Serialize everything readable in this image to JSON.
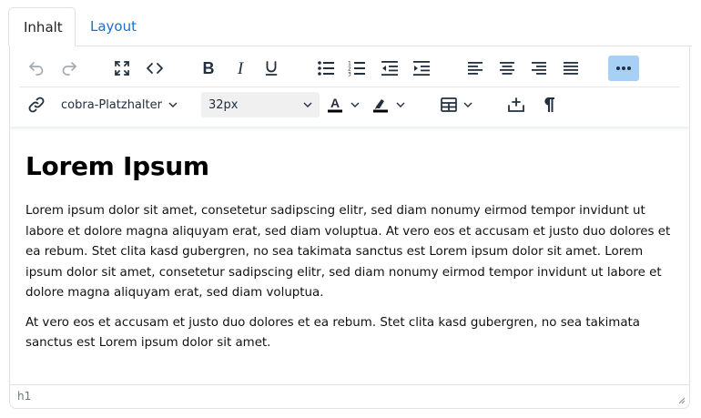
{
  "tabs": [
    {
      "label": "Inhalt",
      "active": true
    },
    {
      "label": "Layout",
      "active": false
    }
  ],
  "toolbar": {
    "row1": [
      {
        "name": "undo-icon",
        "disabled": true
      },
      {
        "name": "redo-icon",
        "disabled": true
      },
      {
        "name": "fullscreen-icon"
      },
      {
        "name": "source-code-icon"
      },
      {
        "name": "bold-icon"
      },
      {
        "name": "italic-icon"
      },
      {
        "name": "underline-icon"
      },
      {
        "name": "bullet-list-icon"
      },
      {
        "name": "numbered-list-icon"
      },
      {
        "name": "outdent-icon"
      },
      {
        "name": "indent-icon"
      },
      {
        "name": "align-left-icon"
      },
      {
        "name": "align-center-icon"
      },
      {
        "name": "align-right-icon"
      },
      {
        "name": "align-justify-icon"
      },
      {
        "name": "more-icon",
        "active": true
      }
    ],
    "placeholder_dropdown": "cobra-Platzhalter",
    "font_size": "32px",
    "text_color": "#000000",
    "highlight_color": "#000000",
    "accent": "#a8d0f5"
  },
  "content": {
    "heading": "Lorem Ipsum",
    "paragraphs": [
      "Lorem ipsum dolor sit amet, consetetur sadipscing elitr, sed diam nonumy eirmod tempor invidunt ut labore et dolore magna aliquyam erat, sed diam voluptua. At vero eos et accusam et justo duo dolores et ea rebum. Stet clita kasd gubergren, no sea takimata sanctus est Lorem ipsum dolor sit amet. Lorem ipsum dolor sit amet, consetetur sadipscing elitr, sed diam nonumy eirmod tempor invidunt ut labore et dolore magna aliquyam erat, sed diam voluptua.",
      "At vero eos et accusam et justo duo dolores et ea rebum. Stet clita kasd gubergren, no sea takimata sanctus est Lorem ipsum dolor sit amet."
    ]
  },
  "statusbar": {
    "path": "h1"
  }
}
